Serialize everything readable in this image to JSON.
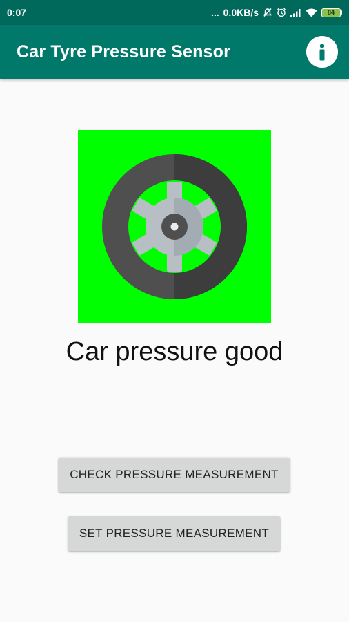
{
  "status_bar": {
    "time": "0:07",
    "dots": "...",
    "network_speed": "0.0KB/s",
    "battery": "84",
    "icons": [
      "mute-icon",
      "alarm-icon",
      "signal-icon",
      "wifi-icon",
      "battery-icon"
    ]
  },
  "app_bar": {
    "title": "Car Tyre Pressure Sensor",
    "info_icon": "info-icon"
  },
  "main": {
    "tyre_image_background": "#00ff00",
    "status_message": "Car pressure good",
    "check_button_label": "CHECK PRESSURE MEASUREMENT",
    "set_button_label": "SET PRESSURE MEASUREMENT"
  },
  "colors": {
    "status_bar": "#00695c",
    "app_bar": "#00796b",
    "tyre_background": "#00ff00",
    "button": "#d6d7d7"
  }
}
